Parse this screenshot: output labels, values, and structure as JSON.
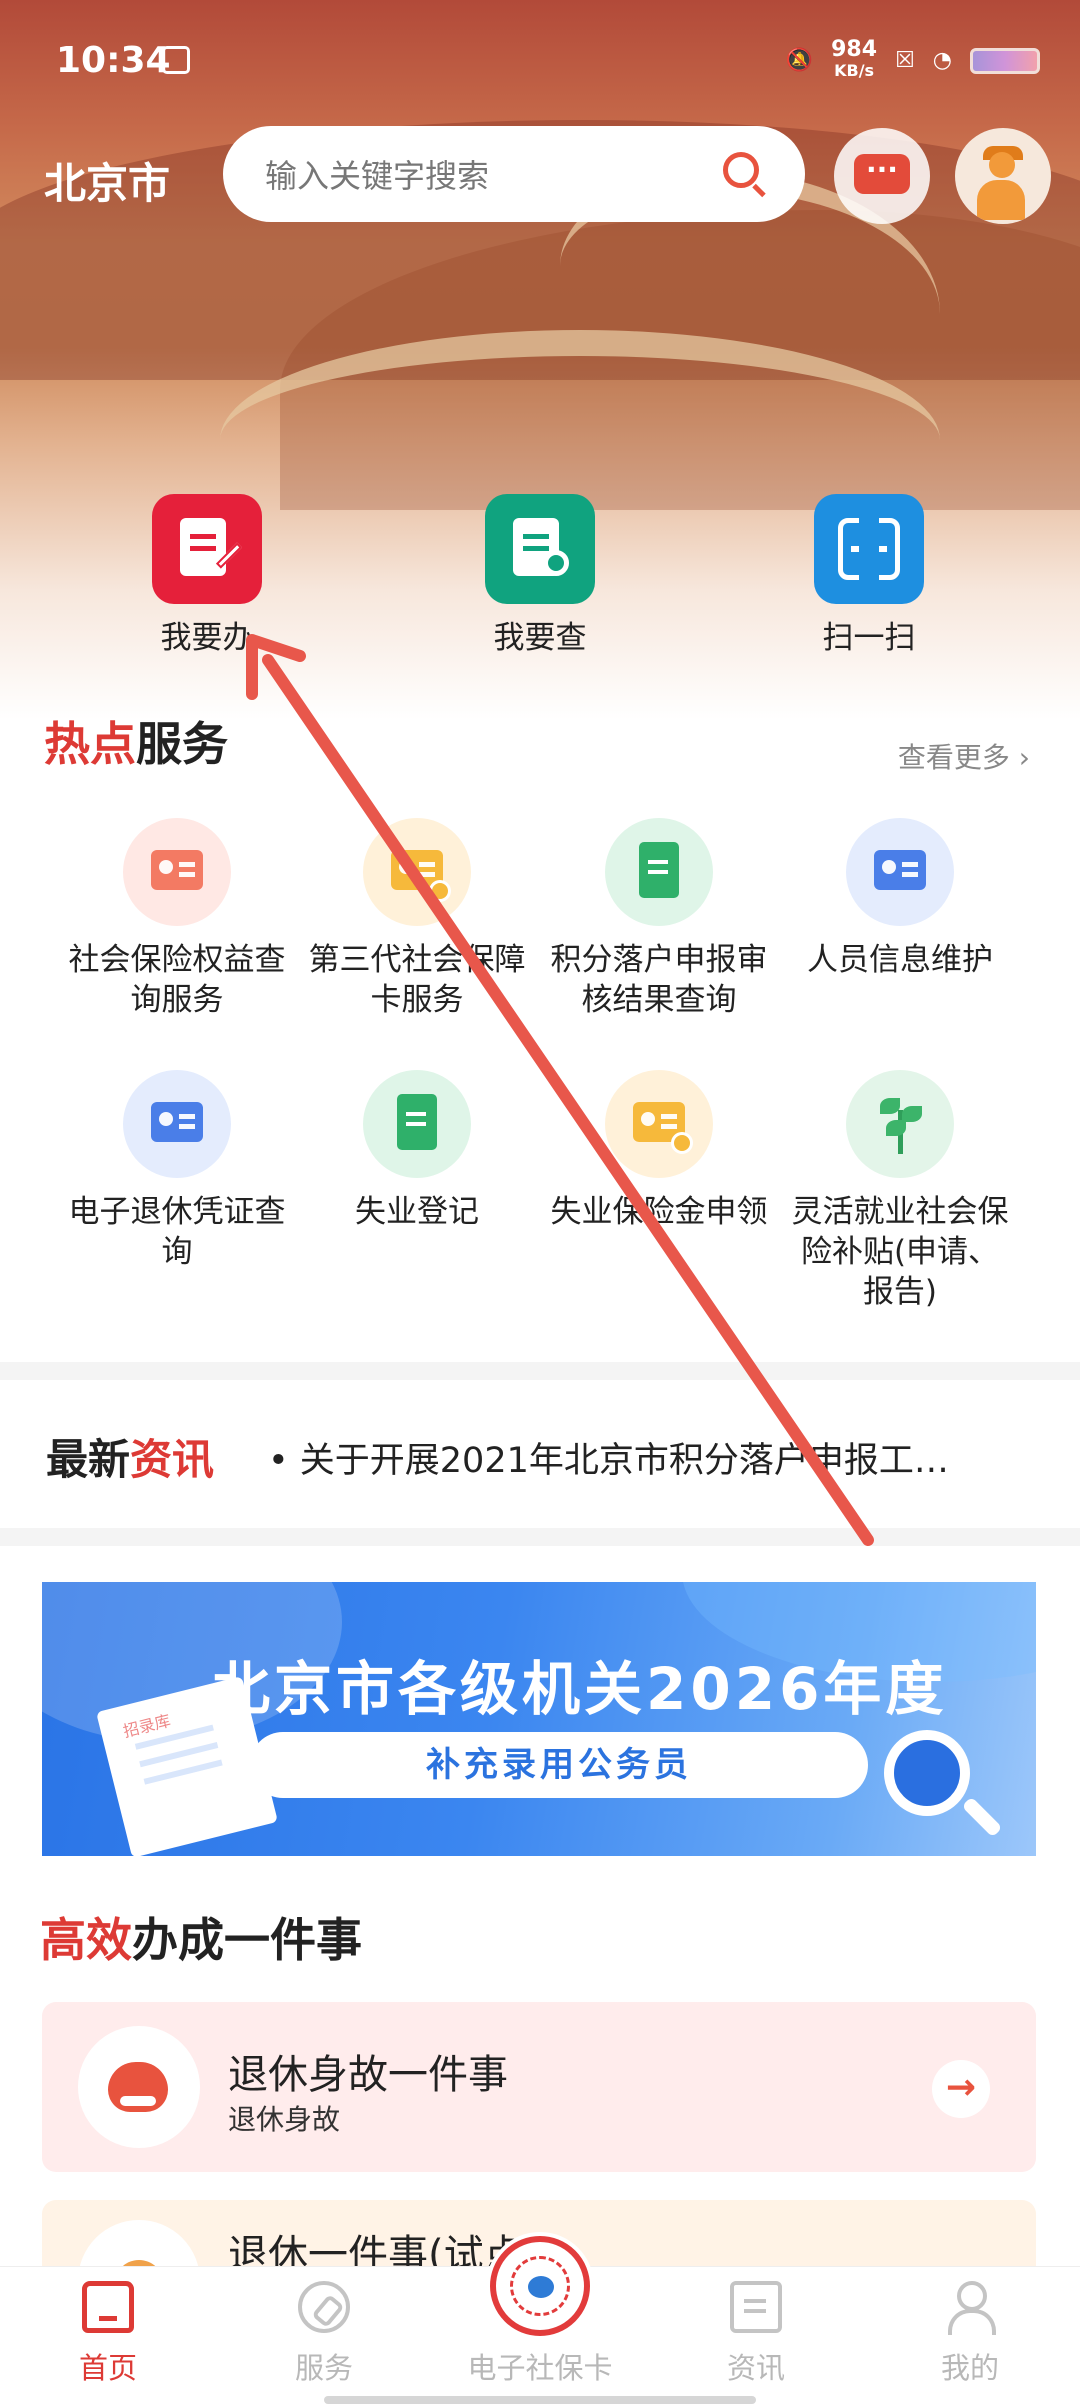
{
  "status_bar": {
    "time": "10:34",
    "speed_value": "984",
    "speed_unit": "KB/s"
  },
  "header": {
    "city": "北京市",
    "search_placeholder": "输入关键字搜索"
  },
  "quick_actions": [
    {
      "label": "我要办",
      "icon": "edit-doc-icon",
      "color": "#e5203a"
    },
    {
      "label": "我要查",
      "icon": "search-doc-icon",
      "color": "#10a37f"
    },
    {
      "label": "扫一扫",
      "icon": "scan-icon",
      "color": "#1e8fe0"
    }
  ],
  "hot_services": {
    "title_accent": "热点",
    "title_rest": "服务",
    "more": "查看更多",
    "items": [
      {
        "label": "社会保险权益查询服务",
        "icon": "insurance-query-icon"
      },
      {
        "label": "第三代社会保障卡服务",
        "icon": "social-card-icon"
      },
      {
        "label": "积分落户申报审核结果查询",
        "icon": "book-icon"
      },
      {
        "label": "人员信息维护",
        "icon": "person-card-icon"
      },
      {
        "label": "电子退休凭证查询",
        "icon": "retirement-card-icon"
      },
      {
        "label": "失业登记",
        "icon": "unemployment-icon"
      },
      {
        "label": "失业保险金申领",
        "icon": "benefit-card-icon"
      },
      {
        "label": "灵活就业社会保险补贴(申请、报告)",
        "icon": "plant-icon"
      }
    ]
  },
  "news": {
    "title_rest": "最新",
    "title_accent": "资讯",
    "item": "关于开展2021年北京市积分落户申报工…"
  },
  "banner": {
    "title": "北京市各级机关2026年度",
    "subtitle": "补充录用公务员",
    "paper_text": "招录库"
  },
  "efficient": {
    "title_accent": "高效",
    "title_rest": "办成一件事",
    "tasks": [
      {
        "title": "退休身故一件事",
        "subtitle": "退休身故"
      },
      {
        "title": "退休一件事(试点)",
        "subtitle": ""
      }
    ]
  },
  "bottom_nav": [
    {
      "label": "首页",
      "icon": "home-icon",
      "active": true
    },
    {
      "label": "服务",
      "icon": "compass-icon",
      "active": false
    },
    {
      "label": "电子社保卡",
      "icon": "social-security-card-icon",
      "active": false
    },
    {
      "label": "资讯",
      "icon": "news-icon",
      "active": false
    },
    {
      "label": "我的",
      "icon": "user-icon",
      "active": false
    }
  ],
  "colors": {
    "brand_red": "#dd3a35",
    "annotation_arrow": "#e8574b"
  }
}
